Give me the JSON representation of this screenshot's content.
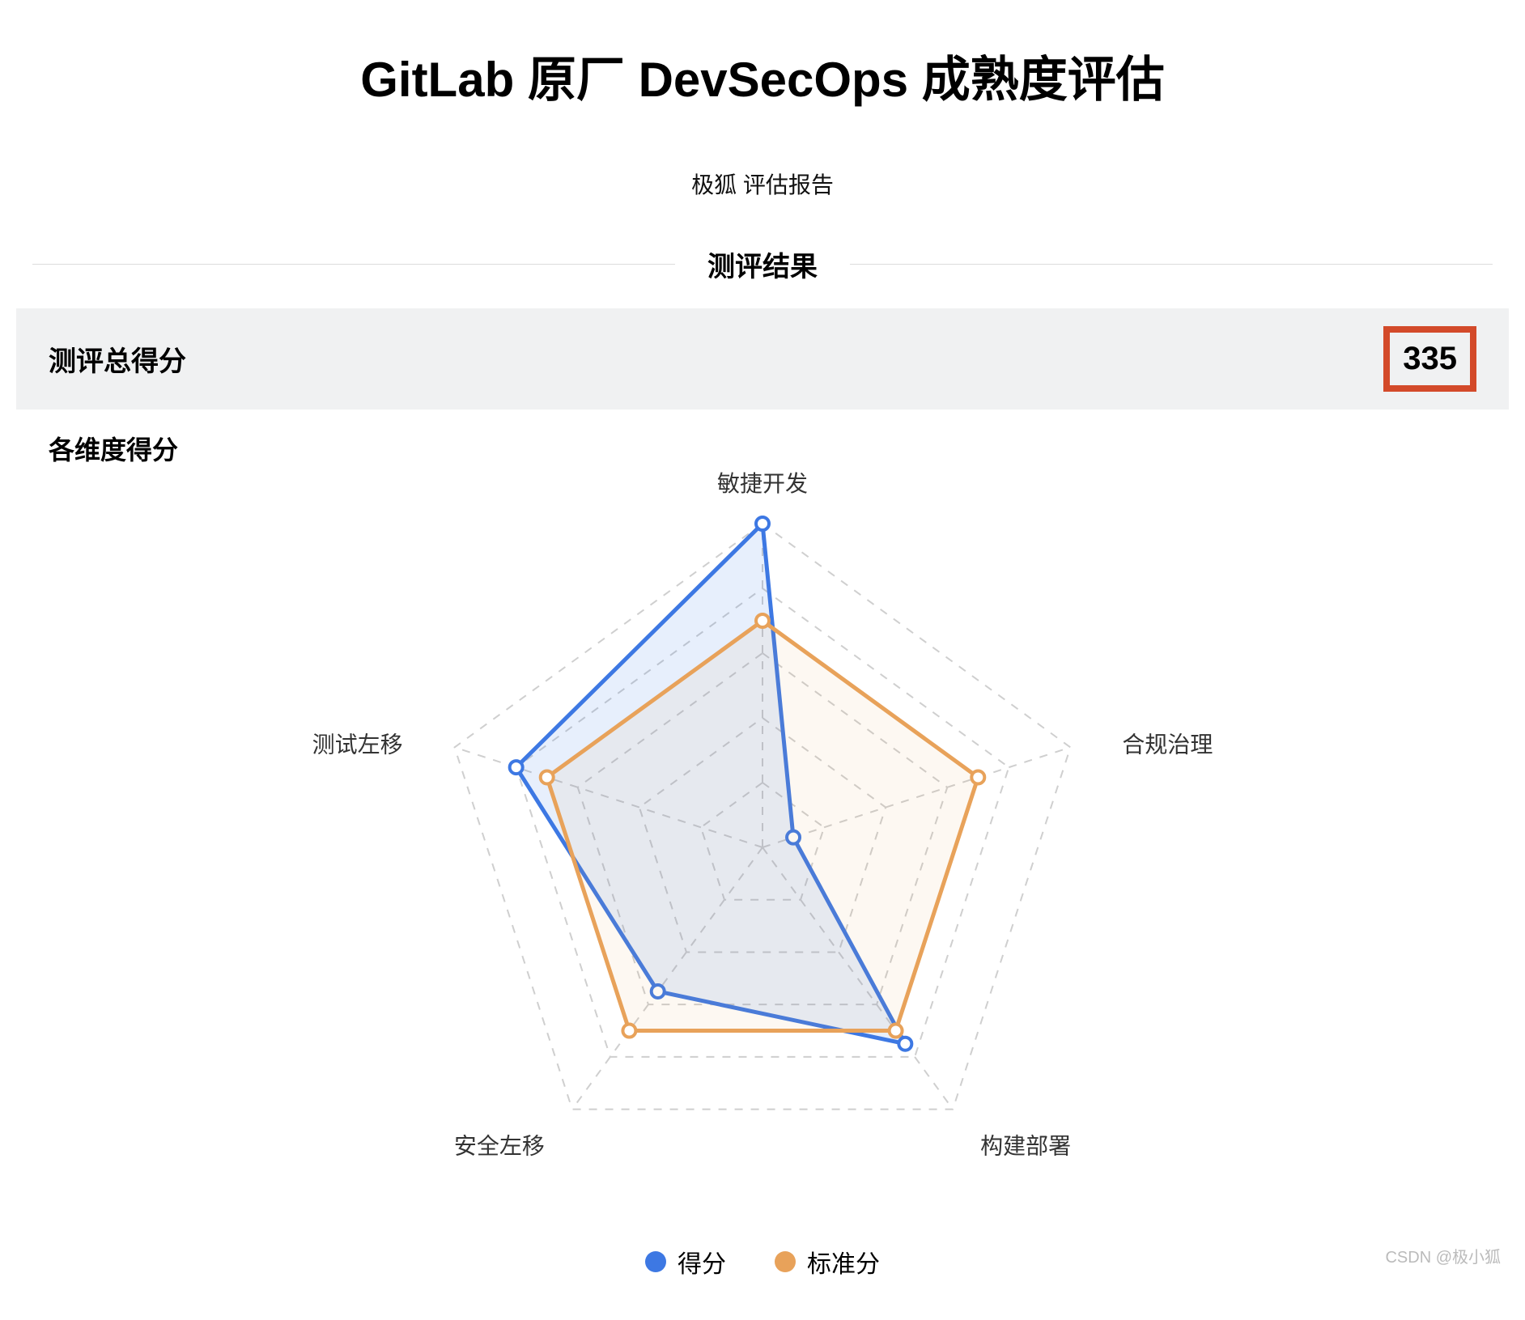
{
  "title": "GitLab 原厂 DevSecOps 成熟度评估",
  "subtitle": "极狐 评估报告",
  "section_label": "测评结果",
  "total_score": {
    "label": "测评总得分",
    "value": "335"
  },
  "dimensions_label": "各维度得分",
  "legend": {
    "score": "得分",
    "standard": "标准分"
  },
  "colors": {
    "score": "#3d78e3",
    "standard": "#e8a25a",
    "grid": "#cfcfcf"
  },
  "watermark": "CSDN @极小狐",
  "chart_data": {
    "type": "radar",
    "categories": [
      "敏捷开发",
      "合规治理",
      "构建部署",
      "安全左移",
      "测试左移"
    ],
    "rings": 5,
    "max": 100,
    "series": [
      {
        "name": "得分",
        "color": "#3d78e3",
        "fill": "rgba(61,120,227,0.12)",
        "values": [
          100,
          10,
          75,
          55,
          80
        ]
      },
      {
        "name": "标准分",
        "color": "#e8a25a",
        "fill": "rgba(232,162,90,0.08)",
        "values": [
          70,
          70,
          70,
          70,
          70
        ]
      }
    ]
  }
}
